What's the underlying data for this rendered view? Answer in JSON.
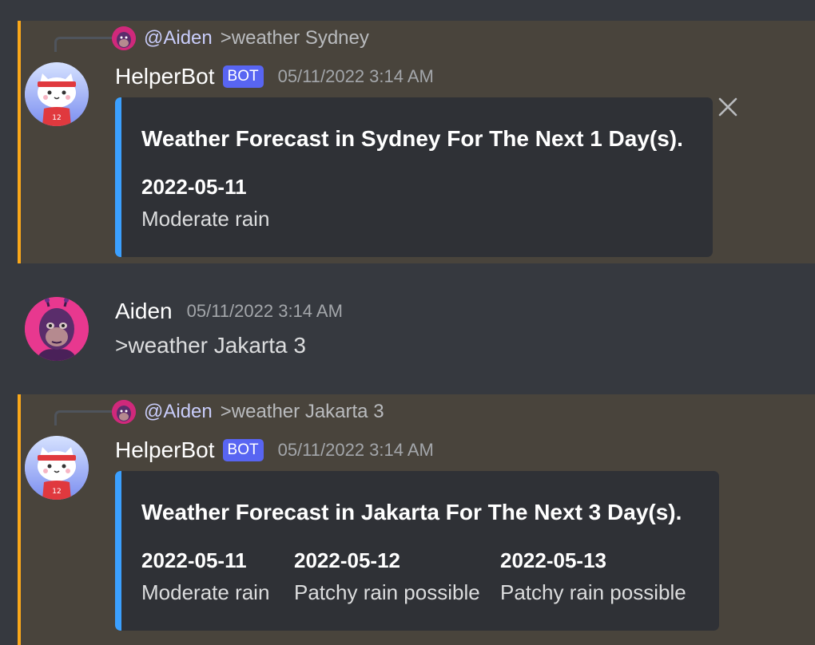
{
  "messages": [
    {
      "reply": {
        "mention": "@Aiden",
        "text": ">weather Sydney"
      },
      "author": "HelperBot",
      "bot_tag": "BOT",
      "timestamp": "05/11/2022 3:14 AM",
      "embed": {
        "title": "Weather Forecast in Sydney For The Next 1 Day(s).",
        "fields": [
          {
            "name": "2022-05-11",
            "value": "Moderate rain"
          }
        ]
      }
    },
    {
      "author": "Aiden",
      "timestamp": "05/11/2022 3:14 AM",
      "content": ">weather Jakarta 3"
    },
    {
      "reply": {
        "mention": "@Aiden",
        "text": ">weather Jakarta 3"
      },
      "author": "HelperBot",
      "bot_tag": "BOT",
      "timestamp": "05/11/2022 3:14 AM",
      "embed": {
        "title": "Weather Forecast in Jakarta For The Next 3 Day(s).",
        "fields": [
          {
            "name": "2022-05-11",
            "value": "Moderate rain"
          },
          {
            "name": "2022-05-12",
            "value": "Patchy rain possible"
          },
          {
            "name": "2022-05-13",
            "value": "Patchy rain possible"
          }
        ]
      }
    }
  ],
  "colors": {
    "background": "#36393f",
    "mention_highlight": "#49443c",
    "mention_bar": "#faa81a",
    "embed_bar": "#3ba0ff",
    "bot_tag": "#5865f2"
  },
  "icons": {
    "dismiss": "close-icon"
  }
}
